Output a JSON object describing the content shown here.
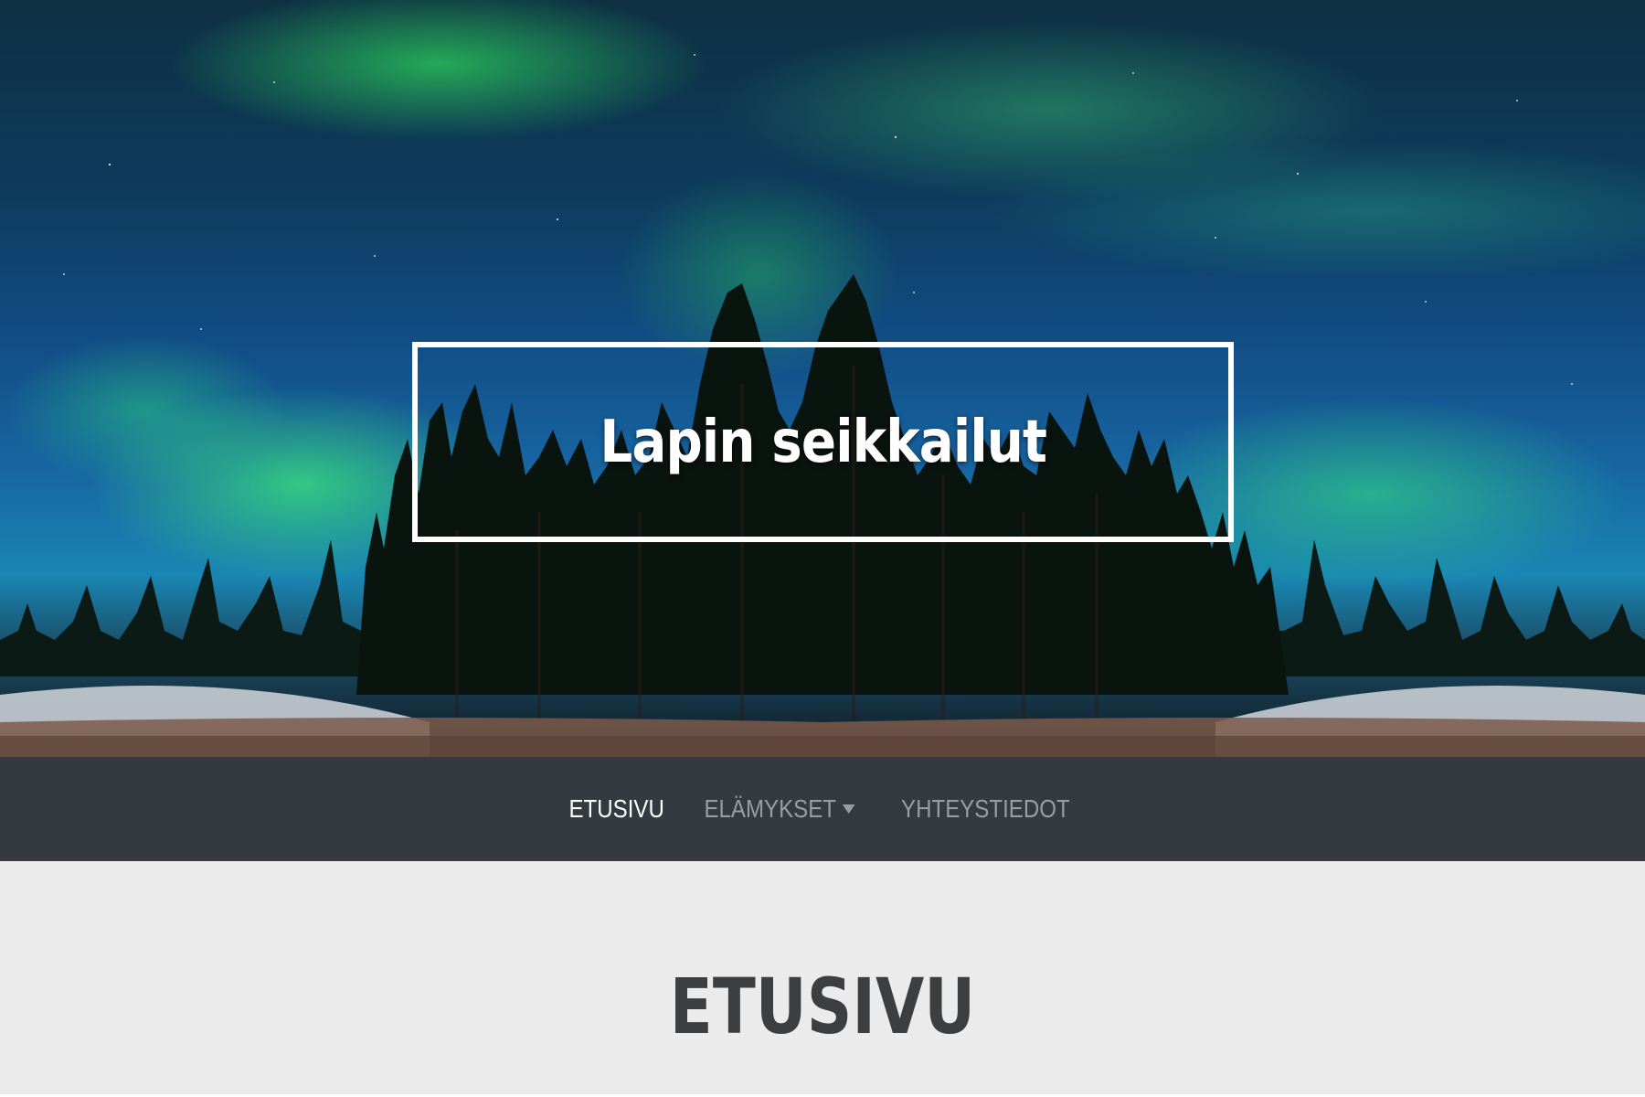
{
  "site": {
    "title": "Lapin seikkailut"
  },
  "nav": {
    "items": [
      {
        "label": "ETUSIVU",
        "active": true
      },
      {
        "label": "ELÄMYKSET",
        "dropdown": true
      },
      {
        "label": "YHTEYSTIEDOT"
      }
    ]
  },
  "main": {
    "heading": "ETUSIVU"
  },
  "icons": {
    "dropdown": "caret-down-icon"
  },
  "colors": {
    "navbar_bg": "#343a40",
    "nav_active": "#ffffff",
    "nav_inactive": "#9a9da2",
    "content_bg": "#ebebeb",
    "heading": "#3d3e40"
  }
}
